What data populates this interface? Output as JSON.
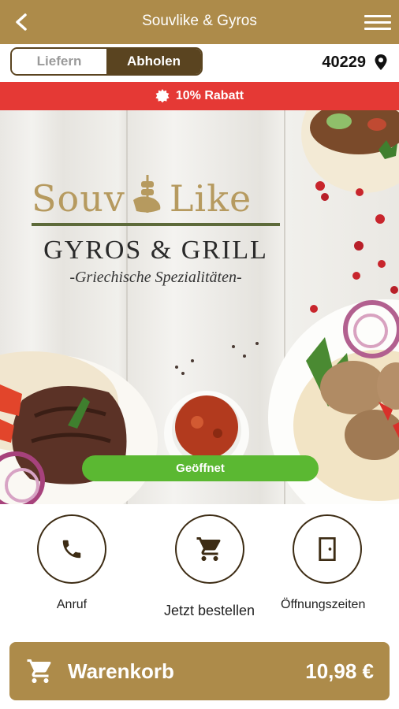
{
  "header": {
    "title": "Souvlike & Gyros",
    "back_icon": "chevron-left-icon",
    "menu_icon": "hamburger-menu-icon"
  },
  "mode_toggle": {
    "options": [
      "Liefern",
      "Abholen"
    ],
    "selected": "Abholen"
  },
  "location": {
    "postal_code": "40229",
    "icon": "map-pin-icon"
  },
  "promo": {
    "label": "10% Rabatt",
    "icon": "discount-badge-icon",
    "color": "#e53935"
  },
  "hero": {
    "logo_word1": "Souv",
    "logo_word2": "Like",
    "logo_subtitle": "GYROS & GRILL",
    "logo_tagline": "-Griechische Spezialitäten-",
    "status": "Geöffnet",
    "status_color": "#5bb832"
  },
  "actions": [
    {
      "label": "Anruf",
      "icon": "phone-icon"
    },
    {
      "label": "Jetzt bestellen",
      "icon": "shopping-cart-icon"
    },
    {
      "label": "Öffnungszeiten",
      "icon": "door-icon"
    }
  ],
  "cart": {
    "label": "Warenkorb",
    "total": "10,98 €",
    "icon": "shopping-cart-icon"
  },
  "colors": {
    "brand": "#ad8b4a",
    "dark_brown": "#5a4420"
  }
}
